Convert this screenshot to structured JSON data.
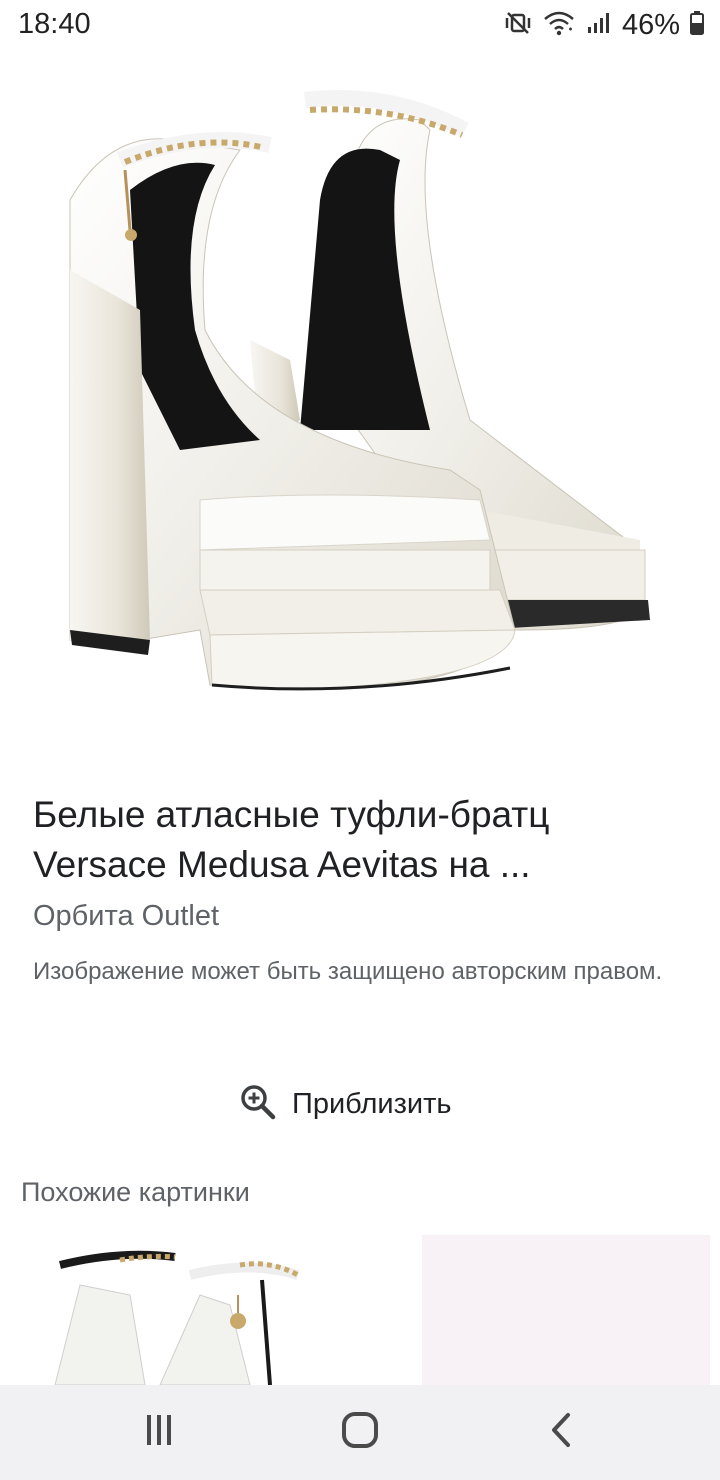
{
  "status_bar": {
    "time": "18:40",
    "battery": "46%",
    "icons": [
      "mute-vibrate-icon",
      "wifi-icon",
      "signal-icon",
      "battery-icon"
    ]
  },
  "hero_image": {
    "icon": "white-platform-heels-photo"
  },
  "result": {
    "title_line1": "Белые атласные туфли-братц",
    "title_line2": "Versace Medusa Aevitas на ...",
    "source": "Орбита Outlet",
    "copyright": "Изображение может быть защищено авторским правом."
  },
  "zoom": {
    "label": "Приблизить",
    "icon": "zoom-in-icon"
  },
  "similar": {
    "heading": "Похожие картинки"
  },
  "nav": {
    "icons": [
      "recent-apps-icon",
      "home-icon",
      "back-icon"
    ]
  }
}
